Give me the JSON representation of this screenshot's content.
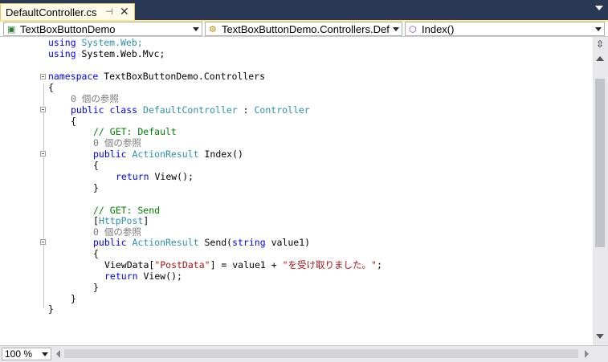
{
  "tab": {
    "title": "DefaultController.cs",
    "pin_icon": "pin-icon",
    "close_icon": "close-icon"
  },
  "navigation": {
    "project": "TextBoxButtonDemo",
    "class": "TextBoxButtonDemo.Controllers.Def",
    "member": "Index()"
  },
  "code": {
    "line1_kw": "using",
    "line1_ns": " System.Web;",
    "line2_kw": "using",
    "line2_ns": " System.Web.Mvc;",
    "ns_kw": "namespace",
    "ns_name": " TextBoxButtonDemo.Controllers",
    "brace_open": "{",
    "brace_close": "}",
    "ref_count": "0 個の参照",
    "class_kw": "public class ",
    "class_name": "DefaultController",
    "class_sep": " : ",
    "base_class": "Controller",
    "comment_default": "// GET: Default",
    "public_kw": "public ",
    "return_type": "ActionResult",
    "index_sig": " Index()",
    "return_kw": "return",
    "return_view": " View();",
    "comment_send": "// GET: Send",
    "attr_open": "[",
    "attr_name": "HttpPost",
    "attr_close": "]",
    "send_sig_1": " Send(",
    "string_kw": "string",
    "send_sig_2": " value1)",
    "viewdata_1": "ViewData[",
    "postdata_str": "\"PostData\"",
    "viewdata_2": "] = value1 + ",
    "msg_str": "\"を受け取りました。\"",
    "viewdata_3": ";"
  },
  "zoom": {
    "value": "100 %"
  },
  "colors": {
    "keyword": "#0000ff",
    "type": "#2b91af",
    "comment": "#008000",
    "string": "#a31515",
    "codelens": "#7a7a7a"
  }
}
